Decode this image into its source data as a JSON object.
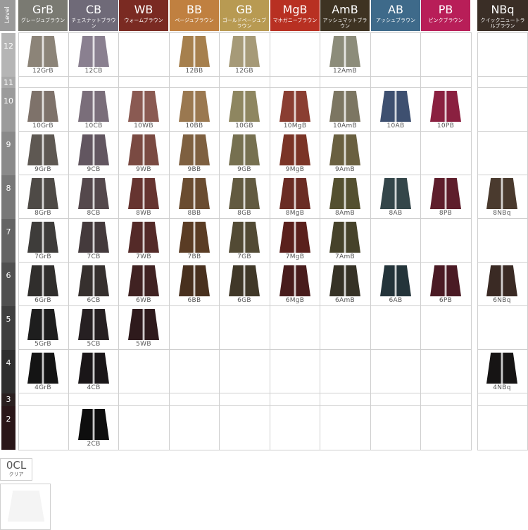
{
  "level_header": "Level",
  "columns": [
    {
      "code": "GrB",
      "jp": "グレージュブラウン",
      "color": "#7a7a72"
    },
    {
      "code": "CB",
      "jp": "チェスナットブラウン",
      "color": "#6f6a78"
    },
    {
      "code": "WB",
      "jp": "ウォームブラウン",
      "color": "#7a2a22"
    },
    {
      "code": "BB",
      "jp": "ベージュブラウン",
      "color": "#c08040"
    },
    {
      "code": "GB",
      "jp": "ゴールドベージュブラウン",
      "color": "#b89a52"
    },
    {
      "code": "MgB",
      "jp": "マホガニーブラウン",
      "color": "#b83022"
    },
    {
      "code": "AmB",
      "jp": "アッシュマットブラウン",
      "color": "#3e3322"
    },
    {
      "code": "AB",
      "jp": "アッシュブラウン",
      "color": "#3e6a8a"
    },
    {
      "code": "PB",
      "jp": "ピンクブラウン",
      "color": "#b81e58"
    },
    {
      "code": "NBq",
      "jp": "クイックニュートラルブラウン",
      "color": "#3a2e26"
    }
  ],
  "levels": [
    {
      "label": "12",
      "color": "#b5b5b5"
    },
    {
      "label": "11",
      "color": "#a9a9a9"
    },
    {
      "label": "10",
      "color": "#9b9b9b"
    },
    {
      "label": "9",
      "color": "#8a8a8a"
    },
    {
      "label": "8",
      "color": "#787878"
    },
    {
      "label": "7",
      "color": "#646464"
    },
    {
      "label": "6",
      "color": "#505050"
    },
    {
      "label": "5",
      "color": "#3f3f3f"
    },
    {
      "label": "4",
      "color": "#2f2f2f"
    },
    {
      "label": "3",
      "color": "#2a1f1f"
    },
    {
      "label": "2",
      "color": "#2a1618"
    }
  ],
  "swatches": [
    {
      "label": "12GrB",
      "col": 0,
      "row": 0,
      "color": "#8c8478"
    },
    {
      "label": "12CB",
      "col": 1,
      "row": 0,
      "color": "#8a8090"
    },
    {
      "label": "12BB",
      "col": 3,
      "row": 0,
      "color": "#a6804e"
    },
    {
      "label": "12GB",
      "col": 4,
      "row": 0,
      "color": "#a69a78"
    },
    {
      "label": "12AmB",
      "col": 6,
      "row": 0,
      "color": "#8c8c7a"
    },
    {
      "label": "10GrB",
      "col": 0,
      "row": 2,
      "color": "#7e726a"
    },
    {
      "label": "10CB",
      "col": 1,
      "row": 2,
      "color": "#7a6e7a"
    },
    {
      "label": "10WB",
      "col": 2,
      "row": 2,
      "color": "#8a5a52"
    },
    {
      "label": "10BB",
      "col": 3,
      "row": 2,
      "color": "#9a7850"
    },
    {
      "label": "10GB",
      "col": 4,
      "row": 2,
      "color": "#8e8660"
    },
    {
      "label": "10MgB",
      "col": 5,
      "row": 2,
      "color": "#8a3e32"
    },
    {
      "label": "10AmB",
      "col": 6,
      "row": 2,
      "color": "#7c7662"
    },
    {
      "label": "10AB",
      "col": 7,
      "row": 2,
      "color": "#3e5070"
    },
    {
      "label": "10PB",
      "col": 8,
      "row": 2,
      "color": "#8a2040"
    },
    {
      "label": "9GrB",
      "col": 0,
      "row": 3,
      "color": "#5e5852"
    },
    {
      "label": "9CB",
      "col": 1,
      "row": 3,
      "color": "#625660"
    },
    {
      "label": "9WB",
      "col": 2,
      "row": 3,
      "color": "#7a4a42"
    },
    {
      "label": "9BB",
      "col": 3,
      "row": 3,
      "color": "#7e6040"
    },
    {
      "label": "9GB",
      "col": 4,
      "row": 3,
      "color": "#767050"
    },
    {
      "label": "9MgB",
      "col": 5,
      "row": 3,
      "color": "#7a3426"
    },
    {
      "label": "9AmB",
      "col": 6,
      "row": 3,
      "color": "#6a6040"
    },
    {
      "label": "8GrB",
      "col": 0,
      "row": 4,
      "color": "#4e4a46"
    },
    {
      "label": "8CB",
      "col": 1,
      "row": 4,
      "color": "#54484c"
    },
    {
      "label": "8WB",
      "col": 2,
      "row": 4,
      "color": "#663430"
    },
    {
      "label": "8BB",
      "col": 3,
      "row": 4,
      "color": "#6a4c30"
    },
    {
      "label": "8GB",
      "col": 4,
      "row": 4,
      "color": "#625a40"
    },
    {
      "label": "8MgB",
      "col": 5,
      "row": 4,
      "color": "#6a2c24"
    },
    {
      "label": "8AmB",
      "col": 6,
      "row": 4,
      "color": "#545030"
    },
    {
      "label": "8AB",
      "col": 7,
      "row": 4,
      "color": "#34464a"
    },
    {
      "label": "8PB",
      "col": 8,
      "row": 4,
      "color": "#5e1e2c"
    },
    {
      "label": "8NBq",
      "col": 9,
      "row": 4,
      "color": "#4a3a2e"
    },
    {
      "label": "7GrB",
      "col": 0,
      "row": 5,
      "color": "#3e3c3a"
    },
    {
      "label": "7CB",
      "col": 1,
      "row": 5,
      "color": "#443a3c"
    },
    {
      "label": "7WB",
      "col": 2,
      "row": 5,
      "color": "#542a28"
    },
    {
      "label": "7BB",
      "col": 3,
      "row": 5,
      "color": "#5a3c24"
    },
    {
      "label": "7GB",
      "col": 4,
      "row": 5,
      "color": "#524a34"
    },
    {
      "label": "7MgB",
      "col": 5,
      "row": 5,
      "color": "#5a201c"
    },
    {
      "label": "7AmB",
      "col": 6,
      "row": 5,
      "color": "#46422a"
    },
    {
      "label": "6GrB",
      "col": 0,
      "row": 6,
      "color": "#302e2c"
    },
    {
      "label": "6CB",
      "col": 1,
      "row": 6,
      "color": "#36302e"
    },
    {
      "label": "6WB",
      "col": 2,
      "row": 6,
      "color": "#402222"
    },
    {
      "label": "6BB",
      "col": 3,
      "row": 6,
      "color": "#48301e"
    },
    {
      "label": "6GB",
      "col": 4,
      "row": 6,
      "color": "#403828"
    },
    {
      "label": "6MgB",
      "col": 5,
      "row": 6,
      "color": "#481c1c"
    },
    {
      "label": "6AmB",
      "col": 6,
      "row": 6,
      "color": "#363226"
    },
    {
      "label": "6AB",
      "col": 7,
      "row": 6,
      "color": "#24343a"
    },
    {
      "label": "6PB",
      "col": 8,
      "row": 6,
      "color": "#4a1a24"
    },
    {
      "label": "6NBq",
      "col": 9,
      "row": 6,
      "color": "#3a2a24"
    },
    {
      "label": "5GrB",
      "col": 0,
      "row": 7,
      "color": "#1e1e1e"
    },
    {
      "label": "5CB",
      "col": 1,
      "row": 7,
      "color": "#262022"
    },
    {
      "label": "5WB",
      "col": 2,
      "row": 7,
      "color": "#2e1a1c"
    },
    {
      "label": "4GrB",
      "col": 0,
      "row": 8,
      "color": "#141414"
    },
    {
      "label": "4CB",
      "col": 1,
      "row": 8,
      "color": "#1a1618"
    },
    {
      "label": "4NBq",
      "col": 9,
      "row": 8,
      "color": "#161414"
    },
    {
      "label": "2CB",
      "col": 1,
      "row": 10,
      "color": "#0e0e0e"
    }
  ],
  "clear": {
    "code": "0CL",
    "jp": "クリア",
    "color": "#f4f4f4"
  }
}
